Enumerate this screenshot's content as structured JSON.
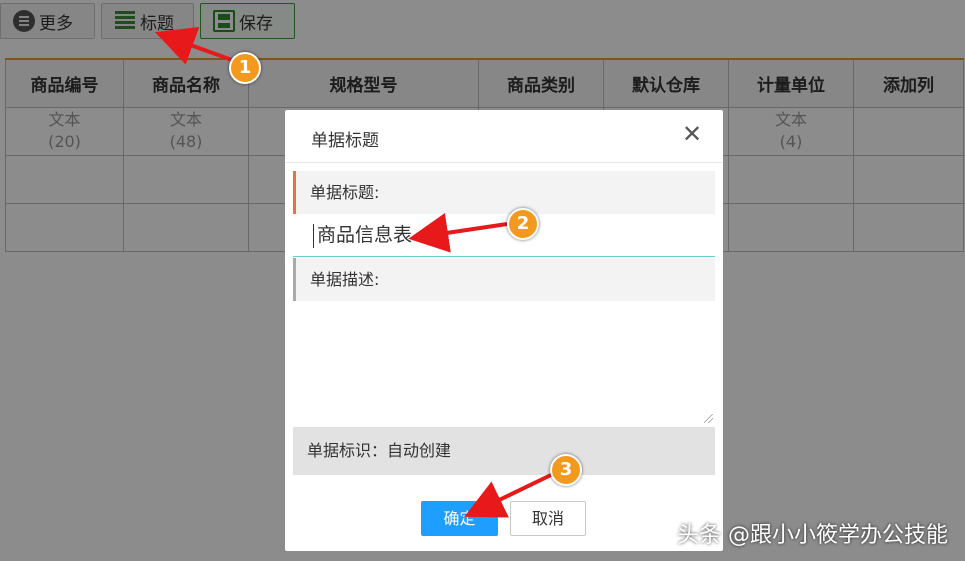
{
  "toolbar": {
    "more_label": "更多",
    "title_label": "标题",
    "save_label": "保存"
  },
  "table": {
    "headers": [
      "商品编号",
      "商品名称",
      "规格型号",
      "商品类别",
      "默认仓库",
      "计量单位",
      "添加列"
    ],
    "type_row": [
      {
        "type": "文本",
        "len": "(20)"
      },
      {
        "type": "文本",
        "len": "(48)"
      },
      {
        "type": "",
        "len": ""
      },
      {
        "type": "",
        "len": ""
      },
      {
        "type": "",
        "len": ""
      },
      {
        "type": "文本",
        "len": "(4)"
      },
      {
        "type": "",
        "len": ""
      }
    ]
  },
  "dialog": {
    "title": "单据标题",
    "close_symbol": "✕",
    "title_label": "单据标题:",
    "title_value": "商品信息表",
    "desc_label": "单据描述:",
    "ident_text": "单据标识：自动创建",
    "ok_label": "确定",
    "cancel_label": "取消"
  },
  "annotations": {
    "badges": [
      "1",
      "2",
      "3"
    ],
    "arrow_color": "#e8191b",
    "badge_color": "#f39a1e"
  },
  "watermark": "头条 @跟小小筱学办公技能"
}
